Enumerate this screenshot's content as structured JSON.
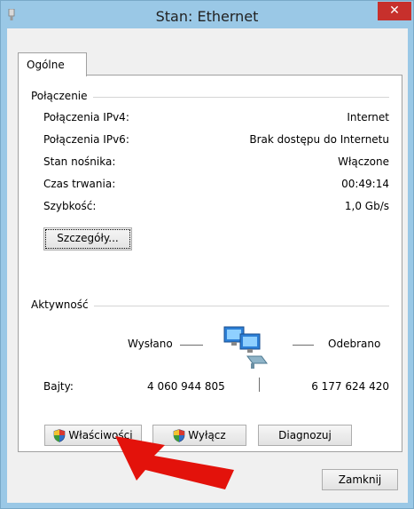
{
  "window": {
    "title": "Stan: Ethernet",
    "close_label": "✕"
  },
  "tabs": [
    {
      "label": "Ogólne"
    }
  ],
  "connection": {
    "section_title": "Połączenie",
    "rows": [
      {
        "label": "Połączenia IPv4:",
        "value": "Internet"
      },
      {
        "label": "Połączenia IPv6:",
        "value": "Brak dostępu do Internetu"
      },
      {
        "label": "Stan nośnika:",
        "value": "Włączone"
      },
      {
        "label": "Czas trwania:",
        "value": "00:49:14"
      },
      {
        "label": "Szybkość:",
        "value": "1,0 Gb/s"
      }
    ],
    "details_button": "Szczegóły..."
  },
  "activity": {
    "section_title": "Aktywność",
    "sent_label": "Wysłano",
    "received_label": "Odebrano",
    "bytes_label": "Bajty:",
    "bytes_sent": "4 060 944 805",
    "bytes_received": "6 177 624 420"
  },
  "buttons": {
    "properties": "Właściwości",
    "disable": "Wyłącz",
    "diagnose": "Diagnozuj",
    "close": "Zamknij"
  },
  "icons": {
    "app": "network-adapter-icon",
    "shield": "uac-shield-icon",
    "network": "network-computers-icon",
    "arrow": "red-pointer-arrow"
  },
  "colors": {
    "title_bar": "#9ac8e6",
    "close": "#c7302c",
    "arrow": "#e3120b"
  }
}
